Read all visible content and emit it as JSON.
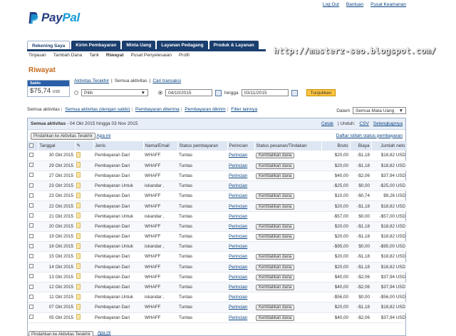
{
  "toplinks": [
    "Log Out",
    "Bantuan",
    "Pusat Keamanan"
  ],
  "logo": {
    "part1": "Pay",
    "part2": "Pal"
  },
  "tabs": [
    "Rekening Saya",
    "Kirim Pembayaran",
    "Minta Uang",
    "Layanan Pedagang",
    "Produk & Layanan"
  ],
  "watermark": "http://masterz-seo.blogspot.com/",
  "subnav": [
    "Tinjauan",
    "Tambah Dana",
    "Tarik",
    "Riwayat",
    "Pusat Penyelesaian",
    "Profil"
  ],
  "page_title": "Riwayat",
  "balance": {
    "label": "Saldo",
    "value": "$75,74",
    "currency": "USD"
  },
  "viewlinks": [
    "Aktivitas Terakhir",
    "Semua aktivitas",
    "Cari transaksi"
  ],
  "filter": {
    "select": "Pilih",
    "date_from": "04/10/2015",
    "between": "hingga",
    "date_to": "03/11/2015",
    "button": "Tunjukkan"
  },
  "sections": [
    "Semua aktivitas",
    "Semua aktivitas (dengan saldo)",
    "Pembayaran diterima",
    "Pembayaran dikirim",
    "Filter lainnya"
  ],
  "currency": {
    "label": "Dalam",
    "value": "Semua Mata Uang"
  },
  "panel": {
    "title": "Semua aktivitas",
    "range": "- 04 Okt 2015 hingga 03 Nov 2015",
    "links": [
      "Cetak",
      "Unduh:",
      "CSV",
      "Selengkapnya"
    ],
    "move_btn": "Pindahkan ke Aktivitas Terakhir",
    "what": "Apa ini",
    "list_link": "Daftar istilah status pembayaran"
  },
  "columns": [
    "Tanggal",
    "",
    "Jenis",
    "Nama/Email",
    "Status pembayaran",
    "Perincian",
    "Status pesanan/Tindakan",
    "Bruto",
    "Biaya",
    "Jumlah neto"
  ],
  "rows": [
    {
      "date": "30 Okt 2015",
      "type": "Pembayaran Dari",
      "name": "WHAFF",
      "status": "Tuntas",
      "detail": "Perincian",
      "action": "Kembalikan dana",
      "gross": "$20,00",
      "fee": "-$1,18",
      "net": "$18,82 USD"
    },
    {
      "date": "29 Okt 2015",
      "type": "Pembayaran Dari",
      "name": "WHAFF",
      "status": "Tuntas",
      "detail": "Perincian",
      "action": "Kembalikan dana",
      "gross": "$20,00",
      "fee": "-$1,18",
      "net": "$18,82 USD"
    },
    {
      "date": "27 Okt 2015",
      "type": "Pembayaran Dari",
      "name": "WHAFF",
      "status": "Tuntas",
      "detail": "Perincian",
      "action": "Kembalikan dana",
      "gross": "$40,00",
      "fee": "-$2,06",
      "net": "$37,94 USD"
    },
    {
      "date": "23 Okt 2015",
      "type": "Pembayaran Untuk",
      "name": "iskandar ,",
      "status": "Tuntas",
      "detail": "Perincian",
      "action": "",
      "gross": "-$25,00",
      "fee": "$0,00",
      "net": "-$25,00 USD"
    },
    {
      "date": "23 Okt 2015",
      "type": "Pembayaran Dari",
      "name": "WHAFF",
      "status": "Tuntas",
      "detail": "Perincian",
      "action": "Kembalikan dana",
      "gross": "$10,00",
      "fee": "-$0,74",
      "net": "$9,26 USD"
    },
    {
      "date": "22 Okt 2015",
      "type": "Pembayaran Dari",
      "name": "WHAFF",
      "status": "Tuntas",
      "detail": "Perincian",
      "action": "Kembalikan dana",
      "gross": "$20,00",
      "fee": "-$1,18",
      "net": "$18,82 USD"
    },
    {
      "date": "21 Okt 2015",
      "type": "Pembayaran Untuk",
      "name": "iskandar ,",
      "status": "Tuntas",
      "detail": "Perincian",
      "action": "",
      "gross": "-$57,00",
      "fee": "$0,00",
      "net": "-$57,00 USD"
    },
    {
      "date": "20 Okt 2015",
      "type": "Pembayaran Dari",
      "name": "WHAFF",
      "status": "Tuntas",
      "detail": "Perincian",
      "action": "Kembalikan dana",
      "gross": "$20,00",
      "fee": "-$1,18",
      "net": "$18,82 USD"
    },
    {
      "date": "19 Okt 2015",
      "type": "Pembayaran Dari",
      "name": "WHAFF",
      "status": "Tuntas",
      "detail": "Perincian",
      "action": "Kembalikan dana",
      "gross": "$20,00",
      "fee": "-$1,18",
      "net": "$18,82 USD"
    },
    {
      "date": "16 Okt 2015",
      "type": "Pembayaran Untuk",
      "name": "iskandar ,",
      "status": "Tuntas",
      "detail": "Perincian",
      "action": "",
      "gross": "-$95,00",
      "fee": "$0,00",
      "net": "-$95,00 USD"
    },
    {
      "date": "15 Okt 2015",
      "type": "Pembayaran Dari",
      "name": "WHAFF",
      "status": "Tuntas",
      "detail": "Perincian",
      "action": "Kembalikan dana",
      "gross": "$20,00",
      "fee": "-$1,18",
      "net": "$18,82 USD"
    },
    {
      "date": "14 Okt 2015",
      "type": "Pembayaran Dari",
      "name": "WHAFF",
      "status": "Tuntas",
      "detail": "Perincian",
      "action": "Kembalikan dana",
      "gross": "$20,00",
      "fee": "-$1,18",
      "net": "$18,82 USD"
    },
    {
      "date": "13 Okt 2015",
      "type": "Pembayaran Dari",
      "name": "WHAFF",
      "status": "Tuntas",
      "detail": "Perincian",
      "action": "Kembalikan dana",
      "gross": "$40,00",
      "fee": "-$2,06",
      "net": "$37,94 USD"
    },
    {
      "date": "12 Okt 2015",
      "type": "Pembayaran Dari",
      "name": "WHAFF",
      "status": "Tuntas",
      "detail": "Perincian",
      "action": "Kembalikan dana",
      "gross": "$40,00",
      "fee": "-$2,06",
      "net": "$37,94 USD"
    },
    {
      "date": "11 Okt 2015",
      "type": "Pembayaran Untuk",
      "name": "iskandar ,",
      "status": "Tuntas",
      "detail": "Perincian",
      "action": "",
      "gross": "-$56,00",
      "fee": "$0,00",
      "net": "-$56,00 USD"
    },
    {
      "date": "07 Okt 2015",
      "type": "Pembayaran Dari",
      "name": "WHAFF",
      "status": "Tuntas",
      "detail": "Perincian",
      "action": "Kembalikan dana",
      "gross": "$20,00",
      "fee": "-$1,18",
      "net": "$18,82 USD"
    },
    {
      "date": "05 Okt 2015",
      "type": "Pembayaran Dari",
      "name": "WHAFF",
      "status": "Tuntas",
      "detail": "Perincian",
      "action": "Kembalikan dana",
      "gross": "$40,00",
      "fee": "-$2,06",
      "net": "$37,94 USD"
    }
  ]
}
